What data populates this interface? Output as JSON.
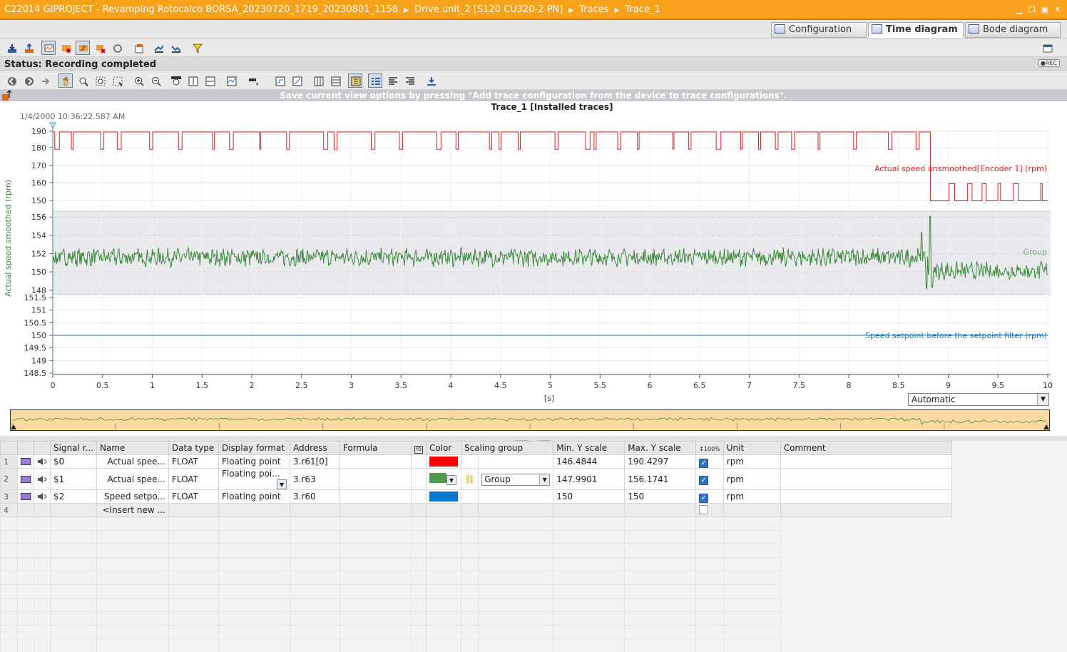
{
  "title": {
    "crumbs": [
      "C22014 GIPROJECT - Revamping Rotocalco BORSA_20230720_1719_20230801_1158",
      "Drive unit_2 [S120 CU320-2 PN]",
      "Traces",
      "Trace_1"
    ]
  },
  "tabs": [
    {
      "label": "Configuration",
      "icon": "configuration-icon"
    },
    {
      "label": "Time diagram",
      "icon": "time-diagram-icon"
    },
    {
      "label": "Bode diagram",
      "icon": "bode-diagram-icon"
    }
  ],
  "status": {
    "text": "Status: Recording completed",
    "badge": "REC"
  },
  "hint": "Save current view options by pressing \"Add trace configuration from the device to trace configurations\".",
  "chart_data": {
    "type": "line",
    "title": "Trace_1 [Installed traces]",
    "timestamp": "1/4/2000  10:36:22.587 AM",
    "xlabel": "[s]",
    "xlim": [
      0,
      10
    ],
    "x_ticks": [
      "0",
      "0.5",
      "1",
      "1.5",
      "2",
      "2.5",
      "3",
      "3.5",
      "4",
      "4.5",
      "5",
      "5.5",
      "6",
      "6.5",
      "7",
      "7.5",
      "8",
      "8.5",
      "9",
      "9.5",
      "10"
    ],
    "series": [
      {
        "name": "Actual speed unsmoothed[Encoder 1] (rpm)",
        "color": "#e02020",
        "ylim": [
          146.4844,
          190.4297
        ],
        "y_ticks": [
          "190",
          "180",
          "170",
          "160",
          "150"
        ],
        "low_after_s": 8.82,
        "levels": [
          180,
          190,
          150,
          160
        ]
      },
      {
        "name": "Group",
        "ylabel": "Actual speed smoothed (rpm)",
        "color": "#3a8a3a",
        "ylim": [
          147.9901,
          156.1741
        ],
        "y_ticks": [
          "156",
          "154",
          "152",
          "150",
          "148"
        ],
        "mean_before": 151.6,
        "mean_after": 150.1,
        "spike_max": 156.1
      },
      {
        "name": "Speed setpoint before the setpoint filter (rpm)",
        "color": "#1a7ab8",
        "ylim": [
          148.5,
          151.5
        ],
        "y_ticks": [
          "151.5",
          "151",
          "150.5",
          "150",
          "149.5",
          "149",
          "148.5"
        ],
        "value": 150
      }
    ]
  },
  "x_mode": "Automatic",
  "table": {
    "headers": [
      "",
      "",
      "",
      "Signal r...",
      "Name",
      "Data type",
      "Display format",
      "Address",
      "Formula",
      "",
      "Color",
      "Scaling group",
      "Min. Y scale",
      "Max. Y scale",
      "",
      "Unit",
      "Comment"
    ],
    "rows": [
      {
        "num": "1",
        "signal": "$0",
        "name": "Actual spee...",
        "dtype": "FLOAT",
        "format": "Floating point",
        "address": "3.r61[0]",
        "color": "#ff0000",
        "group": "",
        "min": "146.4844",
        "max": "190.4297",
        "auto": true,
        "unit": "rpm"
      },
      {
        "num": "2",
        "signal": "$1",
        "name": "Actual spee...",
        "dtype": "FLOAT",
        "format": "Floating poi...",
        "address": "3.r63",
        "color": "#4f9a4f",
        "group": "Group",
        "min": "147.9901",
        "max": "156.1741",
        "auto": true,
        "unit": "rpm"
      },
      {
        "num": "3",
        "signal": "$2",
        "name": "Speed setpo...",
        "dtype": "FLOAT",
        "format": "Floating point",
        "address": "3.r60",
        "color": "#0a78d0",
        "group": "",
        "min": "150",
        "max": "150",
        "auto": true,
        "unit": "rpm"
      }
    ],
    "insert_row": {
      "num": "4",
      "label": "<Insert new ..."
    }
  }
}
